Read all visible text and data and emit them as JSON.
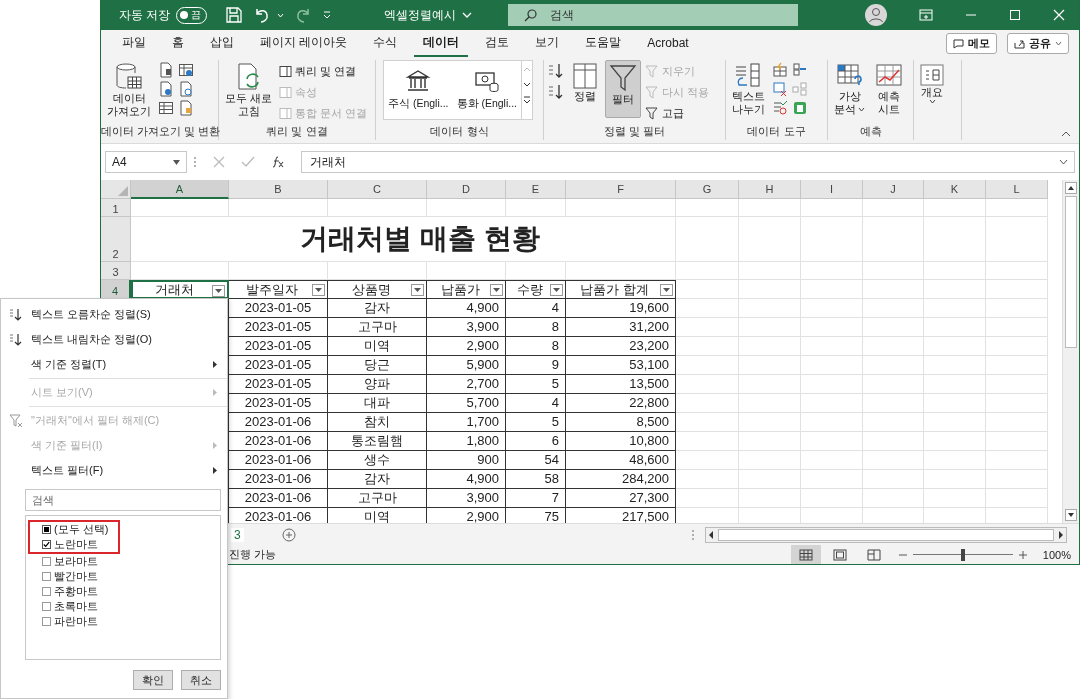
{
  "title_bar": {
    "autosave_label": "자동 저장",
    "autosave_toggle": {
      "label": "끔",
      "on": false
    },
    "file_name": "엑셀정렬예시",
    "search_placeholder": "검색"
  },
  "tabs": [
    {
      "label": "파일",
      "selected": false
    },
    {
      "label": "홈",
      "selected": false
    },
    {
      "label": "삽입",
      "selected": false
    },
    {
      "label": "페이지 레이아웃",
      "selected": false
    },
    {
      "label": "수식",
      "selected": false
    },
    {
      "label": "데이터",
      "selected": true
    },
    {
      "label": "검토",
      "selected": false
    },
    {
      "label": "보기",
      "selected": false
    },
    {
      "label": "도움말",
      "selected": false
    },
    {
      "label": "Acrobat",
      "selected": false
    }
  ],
  "tab_buttons": {
    "comments": "메모",
    "share": "공유"
  },
  "ribbon": {
    "get_transform": {
      "label": "데이터 가져오기 및 변환",
      "get_data": [
        "데이터",
        "가져오기"
      ]
    },
    "queries": {
      "label": "쿼리 및 연결",
      "refresh_all": [
        "모두 새로",
        "고침"
      ],
      "items": [
        {
          "label": "쿼리 및 연결",
          "disabled": false
        },
        {
          "label": "속성",
          "disabled": true
        },
        {
          "label": "통합 문서 연결",
          "disabled": true
        }
      ]
    },
    "data_types": {
      "label": "데이터 형식",
      "items": [
        "주식 (Engli...",
        "통화 (Engli..."
      ]
    },
    "sort_filter": {
      "label": "정렬 및 필터",
      "sort": "정렬",
      "filter": {
        "label": "필터",
        "pressed": true
      },
      "items": [
        {
          "label": "지우기",
          "disabled": true
        },
        {
          "label": "다시 적용",
          "disabled": true
        },
        {
          "label": "고급",
          "disabled": false
        }
      ]
    },
    "data_tools": {
      "label": "데이터 도구",
      "text_to_columns": [
        "텍스트",
        "나누기"
      ]
    },
    "forecast": {
      "label": "예측",
      "what_if": [
        "가상",
        "분석"
      ],
      "sheet": [
        "예측",
        "시트"
      ]
    },
    "outline": {
      "label": "개요"
    }
  },
  "formula_bar": {
    "name_box": "A4",
    "value": "거래처"
  },
  "sheet": {
    "columns": [
      {
        "label": "A",
        "selected": true
      },
      {
        "label": "B",
        "selected": false
      },
      {
        "label": "C",
        "selected": false
      },
      {
        "label": "D",
        "selected": false
      },
      {
        "label": "E",
        "selected": false
      },
      {
        "label": "F",
        "selected": false
      },
      {
        "label": "G",
        "selected": false
      },
      {
        "label": "H",
        "selected": false
      },
      {
        "label": "I",
        "selected": false
      },
      {
        "label": "J",
        "selected": false
      },
      {
        "label": "K",
        "selected": false
      },
      {
        "label": "L",
        "selected": false
      }
    ],
    "row_headers": [
      {
        "label": "1",
        "selected": false
      },
      {
        "label": "2",
        "selected": false
      },
      {
        "label": "3",
        "selected": false
      },
      {
        "label": "4",
        "selected": true
      }
    ],
    "title": "거래처별 매출 현황",
    "table": {
      "headers": [
        "거래처",
        "발주일자",
        "상품명",
        "납품가",
        "수량",
        "납품가 합계"
      ],
      "rows": [
        [
          "2023-01-05",
          "감자",
          "4,900",
          "4",
          "19,600"
        ],
        [
          "2023-01-05",
          "고구마",
          "3,900",
          "8",
          "31,200"
        ],
        [
          "2023-01-05",
          "미역",
          "2,900",
          "8",
          "23,200"
        ],
        [
          "2023-01-05",
          "당근",
          "5,900",
          "9",
          "53,100"
        ],
        [
          "2023-01-05",
          "양파",
          "2,700",
          "5",
          "13,500"
        ],
        [
          "2023-01-05",
          "대파",
          "5,700",
          "4",
          "22,800"
        ],
        [
          "2023-01-06",
          "참치",
          "1,700",
          "5",
          "8,500"
        ],
        [
          "2023-01-06",
          "통조림햄",
          "1,800",
          "6",
          "10,800"
        ],
        [
          "2023-01-06",
          "생수",
          "900",
          "54",
          "48,600"
        ],
        [
          "2023-01-06",
          "감자",
          "4,900",
          "58",
          "284,200"
        ],
        [
          "2023-01-06",
          "고구마",
          "3,900",
          "7",
          "27,300"
        ],
        [
          "2023-01-06",
          "미역",
          "2,900",
          "75",
          "217,500"
        ]
      ]
    }
  },
  "sheet_tabs": {
    "partial_tab": "3"
  },
  "status_bar": {
    "text": "진행 가능",
    "views": [
      {
        "selected": true
      },
      {
        "selected": false
      },
      {
        "selected": false
      }
    ],
    "zoom": {
      "level": 0.5
    },
    "zoom_text": "100%"
  },
  "filter_menu": {
    "items": [
      {
        "kind": "sort_asc",
        "label": "텍스트 오름차순 정렬(S)",
        "disabled": false,
        "submenu": false
      },
      {
        "kind": "sort_desc",
        "label": "텍스트 내림차순 정렬(O)",
        "disabled": false,
        "submenu": false
      },
      {
        "kind": "plain",
        "label": "색 기준 정렬(T)",
        "disabled": false,
        "submenu": true
      },
      {
        "kind": "divider"
      },
      {
        "kind": "plain",
        "label": "시트 보기(V)",
        "disabled": true,
        "submenu": true
      },
      {
        "kind": "divider"
      },
      {
        "kind": "clear_filter",
        "label": "\"거래처\"에서 필터 해제(C)",
        "disabled": true,
        "submenu": false
      },
      {
        "kind": "plain",
        "label": "색 기준 필터(I)",
        "disabled": true,
        "submenu": true
      },
      {
        "kind": "plain",
        "label": "텍스트 필터(F)",
        "disabled": false,
        "submenu": true
      }
    ],
    "search_placeholder": "검색",
    "values": [
      {
        "label": "(모두 선택)",
        "checked": false,
        "partial": true,
        "highlighted": true
      },
      {
        "label": "노란마트",
        "checked": true,
        "partial": false,
        "highlighted": true
      },
      {
        "label": "보라마트",
        "checked": false,
        "partial": false,
        "highlighted": false
      },
      {
        "label": "빨간마트",
        "checked": false,
        "partial": false,
        "highlighted": false
      },
      {
        "label": "주황마트",
        "checked": false,
        "partial": false,
        "highlighted": false
      },
      {
        "label": "초록마트",
        "checked": false,
        "partial": false,
        "highlighted": false
      },
      {
        "label": "파란마트",
        "checked": false,
        "partial": false,
        "highlighted": false
      }
    ],
    "buttons": {
      "ok": "확인",
      "cancel": "취소"
    }
  }
}
